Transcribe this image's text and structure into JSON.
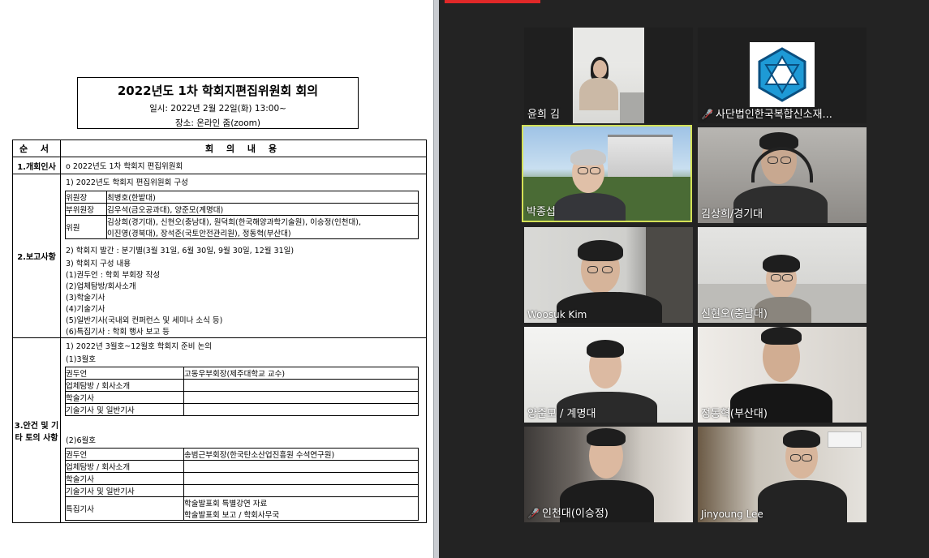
{
  "doc": {
    "title": "2022년도 1차 학회지편집위원회 회의",
    "date": "일시: 2022년 2월 22일(화) 13:00~",
    "place": "장소: 온라인 줌(zoom)",
    "header_order": "순 서",
    "header_content": "회 의 내 용",
    "sections": [
      {
        "name": "1.개회인사",
        "lines": [
          "o 2022년도 1차 학회지 편집위원회"
        ]
      },
      {
        "name": "2.보고사항",
        "lines": [
          "1) 2022년도 학회지 편집위원회 구성",
          "2) 학회지 발간 : 분기별(3월 31일, 6월 30일, 9월 30일, 12월 31일)",
          "3) 학회지 구성 내용",
          " (1)권두언 : 학회 부회장 작성",
          " (2)업체탐방/회사소개",
          " (3)학술기사",
          " (4)기술기사",
          " (5)일반기사(국내외 컨퍼런스 및 세미나 소식 등)",
          " (6)특집기사 : 학회 행사 보고 등"
        ]
      },
      {
        "name": "3.안건 및 기타 토의 사항",
        "lines": [
          "1) 2022년 3월호~12월호 학회지 준비 논의",
          " (1)3월호",
          "(2)6월호"
        ]
      }
    ],
    "committee": [
      {
        "role": "위원장",
        "members": "최병호(한밭대)"
      },
      {
        "role": "부위원장",
        "members": "김우석(금오공과대), 양준모(계명대)"
      },
      {
        "role": "위원",
        "members": "김상희(경기대), 신현오(충남대), 원덕희(한국해양과학기술원), 이승정(인천대),",
        "members2": "이진영(경북대), 장석준(국토안전관리원), 정동혁(부산대)"
      }
    ],
    "march": [
      {
        "k": "권두언",
        "v": "고동우부회장(제주대학교 교수)"
      },
      {
        "k": "업체탐방 / 회사소개",
        "v": ""
      },
      {
        "k": "학술기사",
        "v": ""
      },
      {
        "k": "기술기사 및 일반기사",
        "v": ""
      }
    ],
    "june": [
      {
        "k": "권두언",
        "v": "송범근부회장(한국탄소산업진흥원 수석연구원)"
      },
      {
        "k": "업체탐방 / 회사소개",
        "v": ""
      },
      {
        "k": "학술기사",
        "v": ""
      },
      {
        "k": "기술기사 및 일반기사",
        "v": ""
      },
      {
        "k": "특집기사",
        "v": "학술발표회 특별강연 자료",
        "v2": "학술발표회 보고 / 학회사무국"
      }
    ]
  },
  "participants": [
    {
      "name": "윤희 김",
      "muted": false
    },
    {
      "name": "사단법인한국복합신소재...",
      "muted": true
    },
    {
      "name": "박종섭",
      "muted": false,
      "active": true
    },
    {
      "name": "김상희/경기대",
      "muted": false
    },
    {
      "name": "Woosuk Kim",
      "muted": false
    },
    {
      "name": "신현오(충남대)",
      "muted": false
    },
    {
      "name": "양준모 / 계명대",
      "muted": false
    },
    {
      "name": "정동혁(부산대)",
      "muted": false
    },
    {
      "name": "인천대(이승정)",
      "muted": true
    },
    {
      "name": "Jinyoung Lee",
      "muted": false
    }
  ],
  "colors": {
    "active_border": "#d4e157",
    "mute": "#e03030",
    "background": "#232323"
  },
  "icons": {
    "mute": "microphone-muted-icon",
    "logo": "hexagon-logo-icon"
  }
}
